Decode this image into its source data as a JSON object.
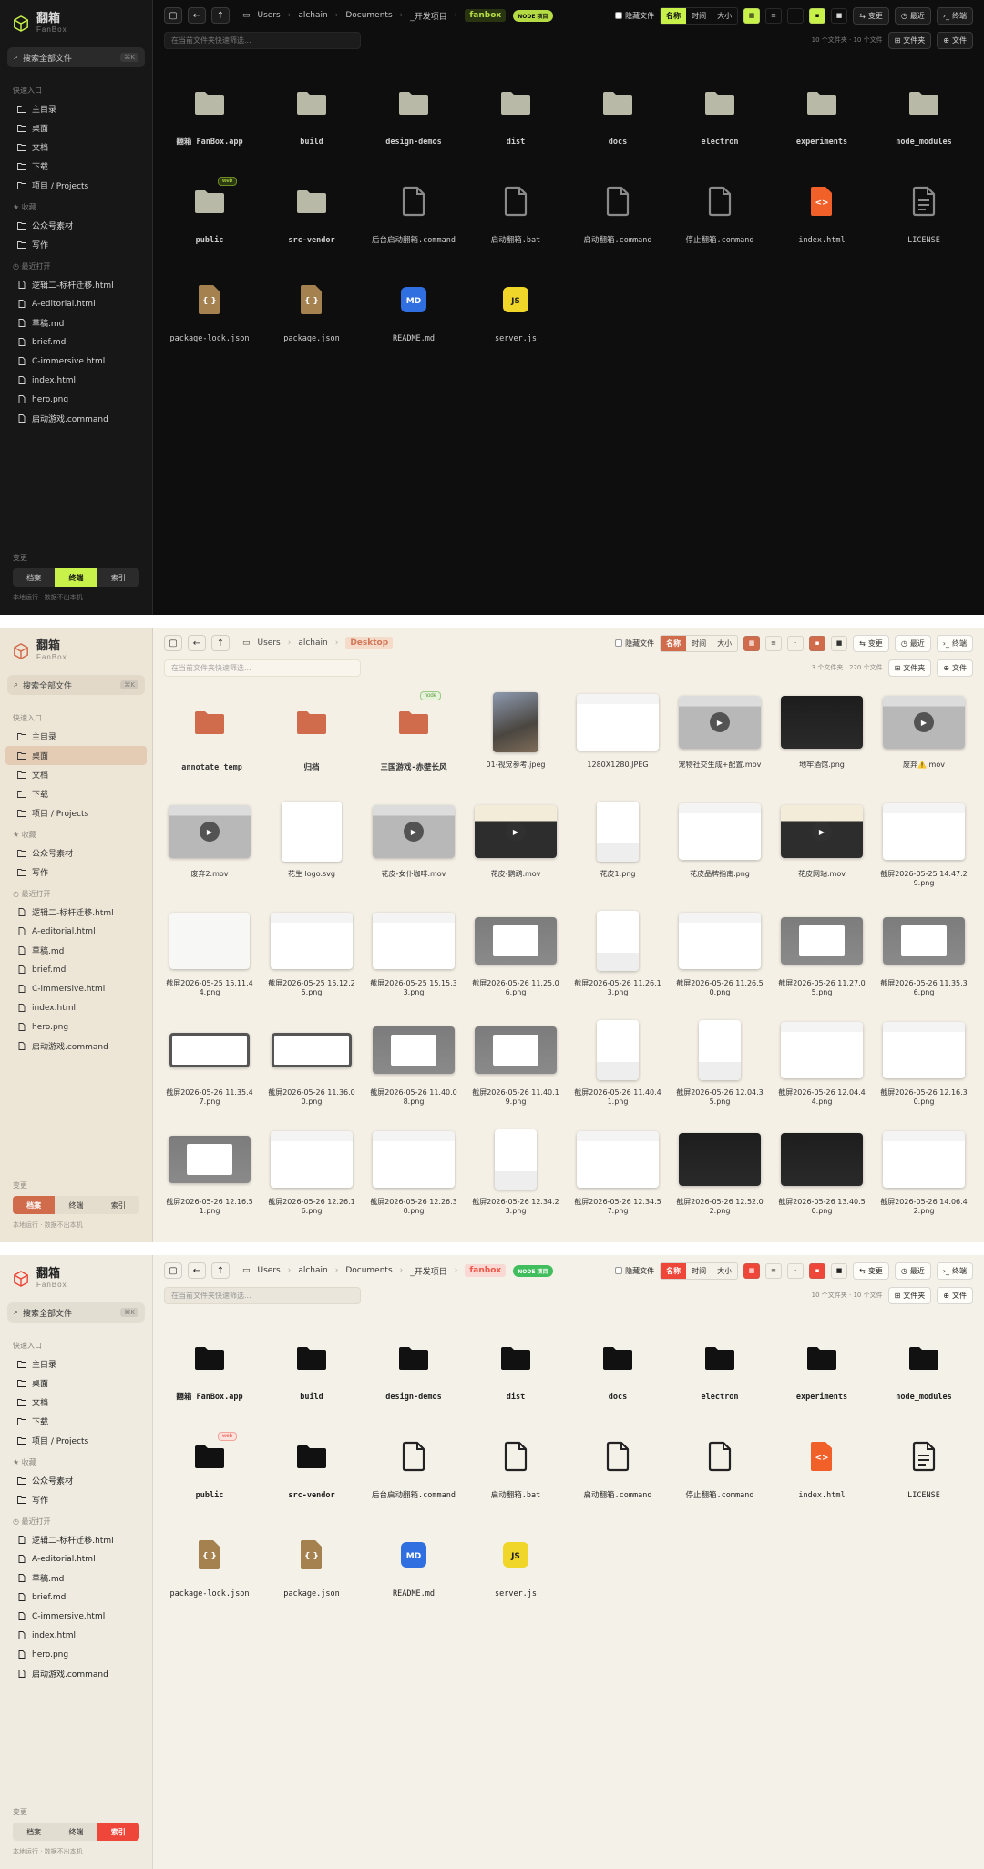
{
  "app": {
    "title": "翻箱",
    "subtitle": "FanBox"
  },
  "sidebar": {
    "search": "搜索全部文件",
    "shortcut": "⌘K",
    "quick_label": "快速入口",
    "quick": [
      "主目录",
      "桌面",
      "文档",
      "下载",
      "项目 / Projects"
    ],
    "fav_label": "收藏",
    "favs": [
      "公众号素材",
      "写作"
    ],
    "recent_label": "最近打开",
    "recents": [
      "逻辑二-标杆迁移.html",
      "A-editorial.html",
      "草稿.md",
      "brief.md",
      "C-immersive.html",
      "index.html",
      "hero.png",
      "启动游戏.command"
    ],
    "mode_label": "变更",
    "modes": [
      "档案",
      "终端",
      "索引"
    ],
    "footer": "本地运行 · 数据不出本机"
  },
  "toolbar": {
    "hidden_label": "隐藏文件",
    "sort": [
      "名称",
      "时间",
      "大小"
    ],
    "changes": "变更",
    "recent": "最近",
    "terminal": "终端"
  },
  "filter_placeholder": "在当前文件夹快速筛选...",
  "btn_folder": "文件夹",
  "btn_file": "文件",
  "colors": {
    "dark_accent": "#c8f24a",
    "warm_accent": "#d06b4b",
    "red_accent": "#ee4739"
  },
  "screens": {
    "s1": {
      "crumbs": [
        "Users",
        "alchain",
        "Documents",
        "_开发项目"
      ],
      "current": "fanbox",
      "badge": "NODE 项目",
      "count": "10 个文件夹 · 10 个文件",
      "active_mode": 1,
      "items": [
        {
          "n": "翻箱 FanBox.app",
          "t": "folder",
          "b": true
        },
        {
          "n": "build",
          "t": "folder",
          "b": true
        },
        {
          "n": "design-demos",
          "t": "folder",
          "b": true
        },
        {
          "n": "dist",
          "t": "folder",
          "b": true
        },
        {
          "n": "docs",
          "t": "folder",
          "b": true
        },
        {
          "n": "electron",
          "t": "folder",
          "b": true
        },
        {
          "n": "experiments",
          "t": "folder",
          "b": true
        },
        {
          "n": "node_modules",
          "t": "folder",
          "b": true
        },
        {
          "n": "public",
          "t": "folder",
          "b": true,
          "tag": "web"
        },
        {
          "n": "src-vendor",
          "t": "folder",
          "b": true
        },
        {
          "n": "后台启动翻箱.command",
          "t": "file"
        },
        {
          "n": "启动翻箱.bat",
          "t": "file"
        },
        {
          "n": "启动翻箱.command",
          "t": "file"
        },
        {
          "n": "停止翻箱.command",
          "t": "file"
        },
        {
          "n": "index.html",
          "t": "html"
        },
        {
          "n": "LICENSE",
          "t": "doc"
        },
        {
          "n": "package-lock.json",
          "t": "json"
        },
        {
          "n": "package.json",
          "t": "json"
        },
        {
          "n": "README.md",
          "t": "md"
        },
        {
          "n": "server.js",
          "t": "js"
        }
      ]
    },
    "s2": {
      "crumbs": [
        "Users",
        "alchain"
      ],
      "current": "Desktop",
      "count": "3 个文件夹 · 220 个文件",
      "active_mode": 0,
      "active_nav": 1,
      "items": [
        {
          "n": "_annotate_temp",
          "t": "folder",
          "b": true
        },
        {
          "n": "归档",
          "t": "folder",
          "b": true
        },
        {
          "n": "三国游戏-赤壁长风",
          "t": "folder",
          "b": true,
          "tag": "node"
        },
        {
          "n": "01-视觉参考.jpeg",
          "t": "photo"
        },
        {
          "n": "1280X1280.JPEG",
          "t": "shot"
        },
        {
          "n": "宠物社交生成+配置.mov",
          "t": "vid"
        },
        {
          "n": "地牢酒馆.png",
          "t": "dark"
        },
        {
          "n": "废弃⚠️.mov",
          "t": "vid"
        },
        {
          "n": "废弃2.mov",
          "t": "vid"
        },
        {
          "n": "花生 logo.svg",
          "t": "white"
        },
        {
          "n": "花皮-女仆咖啡.mov",
          "t": "vid"
        },
        {
          "n": "花皮-鹦鹉.mov",
          "t": "vidd"
        },
        {
          "n": "花皮1.png",
          "t": "phone"
        },
        {
          "n": "花皮品牌指南.png",
          "t": "shot"
        },
        {
          "n": "花皮网站.mov",
          "t": "vidd"
        },
        {
          "n": "截屏2026-05-25 14.47.29.png",
          "t": "shot"
        },
        {
          "n": "截屏2026-05-25 15.11.44.png",
          "t": "lovart"
        },
        {
          "n": "截屏2026-05-25 15.12.25.png",
          "t": "shot"
        },
        {
          "n": "截屏2026-05-25 15.15.33.png",
          "t": "shot"
        },
        {
          "n": "截屏2026-05-26 11.25.06.png",
          "t": "gray"
        },
        {
          "n": "截屏2026-05-26 11.26.13.png",
          "t": "phone"
        },
        {
          "n": "截屏2026-05-26 11.26.50.png",
          "t": "shot"
        },
        {
          "n": "截屏2026-05-26 11.27.05.png",
          "t": "gray"
        },
        {
          "n": "截屏2026-05-26 11.35.36.png",
          "t": "gray"
        },
        {
          "n": "截屏2026-05-26 11.35.47.png",
          "t": "frame"
        },
        {
          "n": "截屏2026-05-26 11.36.00.png",
          "t": "frame"
        },
        {
          "n": "截屏2026-05-26 11.40.08.png",
          "t": "gray"
        },
        {
          "n": "截屏2026-05-26 11.40.19.png",
          "t": "gray"
        },
        {
          "n": "截屏2026-05-26 11.40.41.png",
          "t": "phone"
        },
        {
          "n": "截屏2026-05-26 12.04.35.png",
          "t": "phone"
        },
        {
          "n": "截屏2026-05-26 12.04.44.png",
          "t": "shot"
        },
        {
          "n": "截屏2026-05-26 12.16.30.png",
          "t": "shot"
        },
        {
          "n": "截屏2026-05-26 12.16.51.png",
          "t": "gray"
        },
        {
          "n": "截屏2026-05-26 12.26.16.png",
          "t": "shot"
        },
        {
          "n": "截屏2026-05-26 12.26.30.png",
          "t": "shot"
        },
        {
          "n": "截屏2026-05-26 12.34.23.png",
          "t": "phone"
        },
        {
          "n": "截屏2026-05-26 12.34.57.png",
          "t": "shot"
        },
        {
          "n": "截屏2026-05-26 12.52.02.png",
          "t": "dark"
        },
        {
          "n": "截屏2026-05-26 13.40.50.png",
          "t": "dark"
        },
        {
          "n": "截屏2026-05-26 14.06.42.png",
          "t": "shot"
        }
      ]
    },
    "s3": {
      "crumbs": [
        "Users",
        "alchain",
        "Documents",
        "_开发项目"
      ],
      "current": "fanbox",
      "badge": "NODE 项目",
      "count": "10 个文件夹 · 10 个文件",
      "active_mode": 2,
      "items": [
        {
          "n": "翻箱 FanBox.app",
          "t": "folder",
          "b": true
        },
        {
          "n": "build",
          "t": "folder",
          "b": true
        },
        {
          "n": "design-demos",
          "t": "folder",
          "b": true
        },
        {
          "n": "dist",
          "t": "folder",
          "b": true
        },
        {
          "n": "docs",
          "t": "folder",
          "b": true
        },
        {
          "n": "electron",
          "t": "folder",
          "b": true
        },
        {
          "n": "experiments",
          "t": "folder",
          "b": true
        },
        {
          "n": "node_modules",
          "t": "folder",
          "b": true
        },
        {
          "n": "public",
          "t": "folder",
          "b": true,
          "tag": "web"
        },
        {
          "n": "src-vendor",
          "t": "folder",
          "b": true
        },
        {
          "n": "后台启动翻箱.command",
          "t": "file"
        },
        {
          "n": "启动翻箱.bat",
          "t": "file"
        },
        {
          "n": "启动翻箱.command",
          "t": "file"
        },
        {
          "n": "停止翻箱.command",
          "t": "file"
        },
        {
          "n": "index.html",
          "t": "html"
        },
        {
          "n": "LICENSE",
          "t": "doc"
        },
        {
          "n": "package-lock.json",
          "t": "json"
        },
        {
          "n": "package.json",
          "t": "json"
        },
        {
          "n": "README.md",
          "t": "md"
        },
        {
          "n": "server.js",
          "t": "js"
        }
      ]
    }
  }
}
